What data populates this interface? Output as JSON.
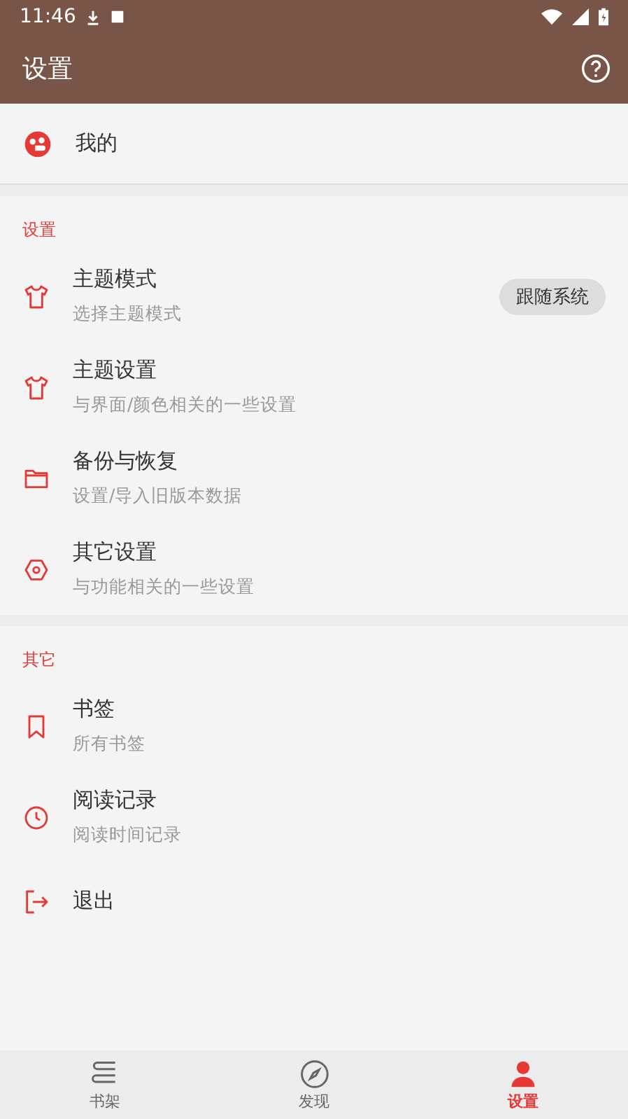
{
  "status_bar": {
    "time": "11:46"
  },
  "app_bar": {
    "title": "设置"
  },
  "profile": {
    "label": "我的"
  },
  "sections": [
    {
      "title": "设置",
      "items": [
        {
          "title": "主题模式",
          "subtitle": "选择主题模式",
          "value": "跟随系统"
        },
        {
          "title": "主题设置",
          "subtitle": "与界面/颜色相关的一些设置"
        },
        {
          "title": "备份与恢复",
          "subtitle": "设置/导入旧版本数据"
        },
        {
          "title": "其它设置",
          "subtitle": "与功能相关的一些设置"
        }
      ]
    },
    {
      "title": "其它",
      "items": [
        {
          "title": "书签",
          "subtitle": "所有书签"
        },
        {
          "title": "阅读记录",
          "subtitle": "阅读时间记录"
        },
        {
          "title": "退出"
        }
      ]
    }
  ],
  "bottom_nav": [
    {
      "label": "书架",
      "selected": false
    },
    {
      "label": "发现",
      "selected": false
    },
    {
      "label": "设置",
      "selected": true
    }
  ]
}
